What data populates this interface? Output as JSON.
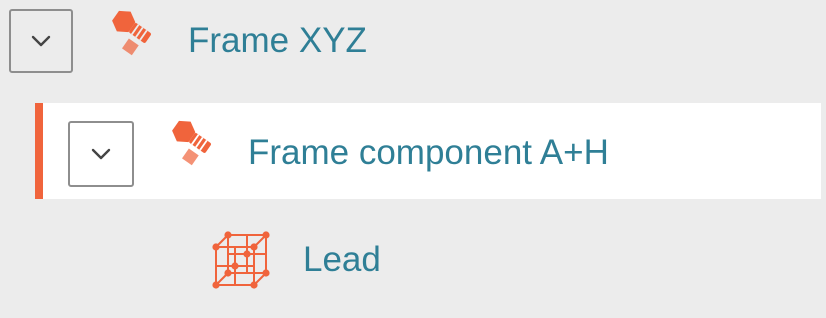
{
  "colors": {
    "accent": "#f0643c",
    "icon": "#f0643c",
    "label": "#2f7f96",
    "selected_row_background": "#ffffff",
    "background": "#ececec",
    "toggle_border": "#8e8e8e"
  },
  "tree": {
    "nodes": [
      {
        "label": "Frame XYZ",
        "icon": "bolt-nut-icon",
        "toggle_icon": "chevron-down-icon",
        "expanded": true,
        "selected": false
      },
      {
        "label": "Frame component A+H",
        "icon": "bolt-nut-icon",
        "toggle_icon": "chevron-down-icon",
        "expanded": true,
        "selected": true
      },
      {
        "label": "Lead",
        "icon": "cube-frame-icon",
        "selected": false
      }
    ]
  }
}
